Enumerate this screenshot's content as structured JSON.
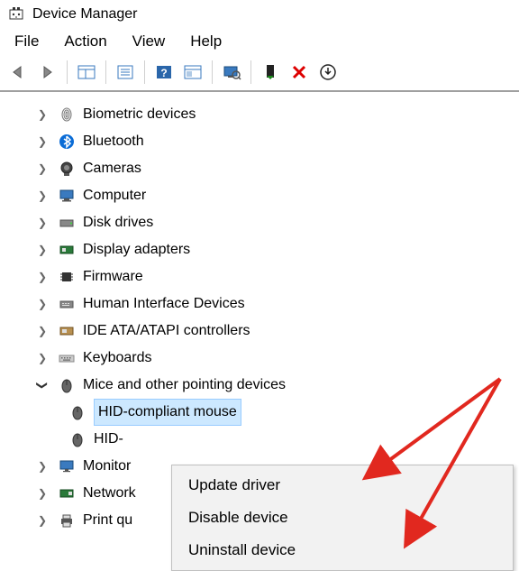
{
  "window": {
    "title": "Device Manager"
  },
  "menus": {
    "file": "File",
    "action": "Action",
    "view": "View",
    "help": "Help"
  },
  "tree": {
    "items": [
      {
        "label": "Biometric devices",
        "expanded": false,
        "icon": "biometric"
      },
      {
        "label": "Bluetooth",
        "expanded": false,
        "icon": "bluetooth"
      },
      {
        "label": "Cameras",
        "expanded": false,
        "icon": "camera"
      },
      {
        "label": "Computer",
        "expanded": false,
        "icon": "computer"
      },
      {
        "label": "Disk drives",
        "expanded": false,
        "icon": "disk"
      },
      {
        "label": "Display adapters",
        "expanded": false,
        "icon": "display"
      },
      {
        "label": "Firmware",
        "expanded": false,
        "icon": "firmware"
      },
      {
        "label": "Human Interface Devices",
        "expanded": false,
        "icon": "hid"
      },
      {
        "label": "IDE ATA/ATAPI controllers",
        "expanded": false,
        "icon": "ide"
      },
      {
        "label": "Keyboards",
        "expanded": false,
        "icon": "keyboard"
      },
      {
        "label": "Mice and other pointing devices",
        "expanded": true,
        "icon": "mouse",
        "children": [
          {
            "label": "HID-compliant mouse",
            "icon": "mouse",
            "selected": true
          },
          {
            "label": "HID-",
            "icon": "mouse",
            "selected": false
          }
        ]
      },
      {
        "label": "Monitor",
        "expanded": false,
        "icon": "monitor",
        "truncated": false
      },
      {
        "label": "Network",
        "expanded": false,
        "icon": "network",
        "truncated": false
      },
      {
        "label": "Print qu",
        "expanded": false,
        "icon": "printer",
        "truncated": true
      }
    ]
  },
  "context_menu": {
    "items": [
      "Update driver",
      "Disable device",
      "Uninstall device"
    ]
  }
}
